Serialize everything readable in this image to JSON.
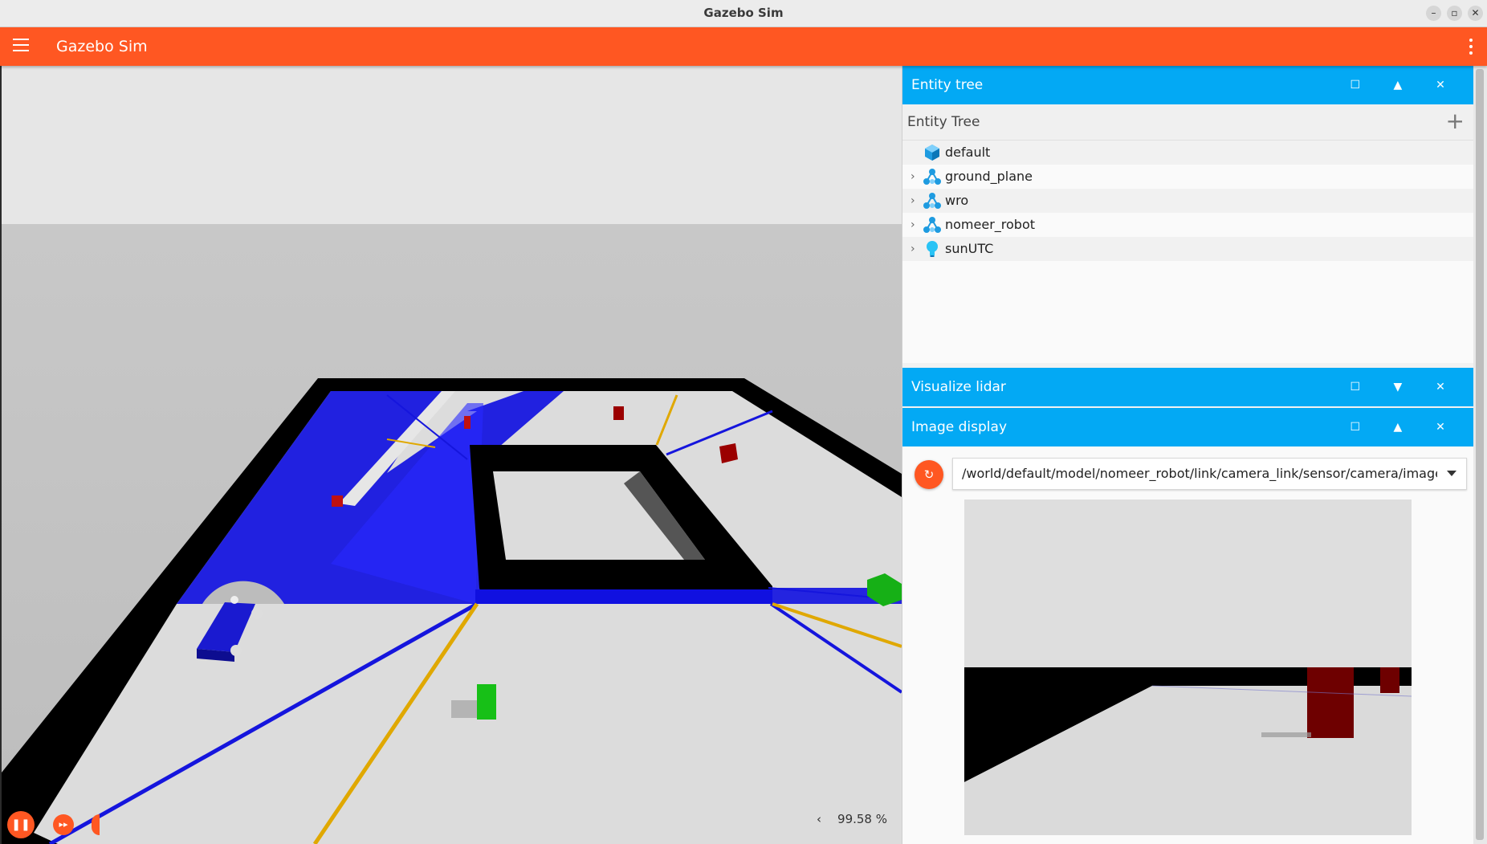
{
  "window": {
    "title": "Gazebo Sim"
  },
  "appbar": {
    "title": "Gazebo Sim"
  },
  "scene": {
    "playback": {
      "pause_symbol": "❚❚",
      "step_symbol": "▸▸"
    },
    "real_time_factor": "99.58 %",
    "rtf_toggle": "‹"
  },
  "panels": {
    "entity_tree": {
      "title": "Entity tree",
      "max": "☐",
      "collapse": "▲",
      "close": "✕"
    },
    "visualize_lidar": {
      "title": "Visualize lidar",
      "max": "☐",
      "expand": "▼",
      "close": "✕"
    },
    "image_display": {
      "title": "Image display",
      "max": "☐",
      "collapse": "▲",
      "close": "✕"
    }
  },
  "entity_tree": {
    "header": "Entity Tree",
    "add_symbol": "+",
    "items": [
      {
        "label": "default",
        "icon": "world-cube-icon",
        "expandable": false
      },
      {
        "label": "ground_plane",
        "icon": "model-icon",
        "expandable": true
      },
      {
        "label": "wro",
        "icon": "model-icon",
        "expandable": true
      },
      {
        "label": "nomeer_robot",
        "icon": "model-icon",
        "expandable": true
      },
      {
        "label": "sunUTC",
        "icon": "light-bulb-icon",
        "expandable": true
      }
    ]
  },
  "image_display": {
    "refresh_symbol": "↻",
    "topic": "/world/default/model/nomeer_robot/link/camera_link/sensor/camera/image"
  },
  "colors": {
    "accent": "#ff5722",
    "panel_header": "#03a9f4",
    "lidar": "#0000e6",
    "wall": "#000000",
    "obstacle_red": "#a00000",
    "obstacle_green": "#16b016",
    "line_orange": "#e0a800"
  }
}
